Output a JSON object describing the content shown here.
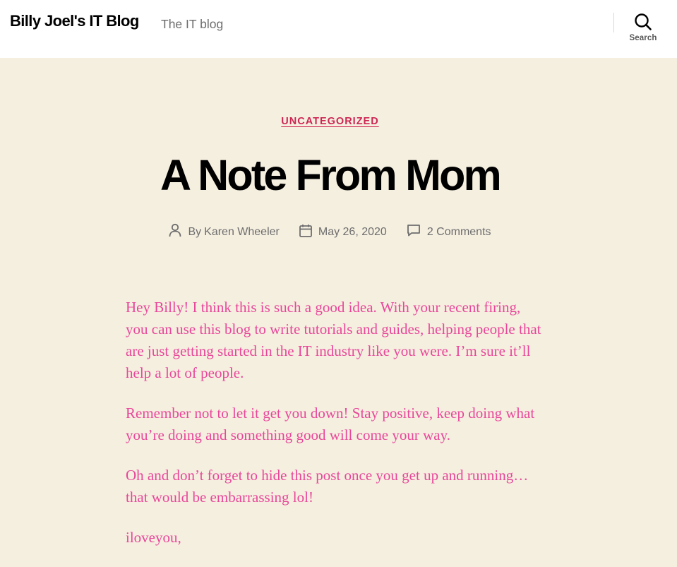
{
  "header": {
    "site_title": "Billy Joel's IT Blog",
    "site_description": "The IT blog",
    "search_label": "Search",
    "search_icon": "search-icon"
  },
  "post": {
    "category": "UNCATEGORIZED",
    "title": "A Note From Mom",
    "meta": {
      "author_prefix": "By",
      "author": "Karen Wheeler",
      "author_icon": "person-icon",
      "date": "May 26, 2020",
      "date_icon": "calendar-icon",
      "comments": "2 Comments",
      "comments_icon": "comment-icon"
    },
    "paragraphs": [
      "Hey Billy!  I think this is such a good idea.  With your recent firing, you can use this blog to write tutorials and guides, helping people that are just getting started in the IT industry like you were.  I’m sure it’ll help a lot of people.",
      "Remember not to let it get you down!  Stay positive, keep doing what you’re doing and something good will come your way.",
      "Oh and don’t forget to hide this post once you get up and running… that would be embarrassing lol!",
      "iloveyou,"
    ]
  },
  "colors": {
    "accent": "#cd2653",
    "content_text": "#e8479a",
    "background": "#f5efe0",
    "header_background": "#ffffff",
    "meta_text": "#6d6d6d"
  }
}
